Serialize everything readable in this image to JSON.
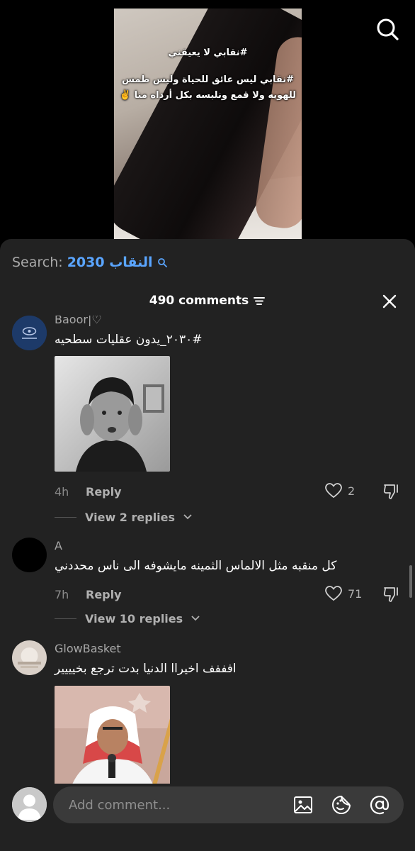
{
  "video": {
    "overlay_line1": "#نقابي لا يعيقني",
    "overlay_line2": "#نقابي ليس عائق للحياة وليس طمس",
    "overlay_line3": "للهويه ولا قمع ونلبسه بكل أرداه منا ✌️"
  },
  "search": {
    "label": "Search:",
    "term": "2030 النقاب"
  },
  "comments_header": {
    "count_label": "490 comments"
  },
  "comments": [
    {
      "username": "Baoor|♡",
      "text": "#٢٠٣٠_يدون عقليات سطحيه",
      "time": "4h",
      "reply_label": "Reply",
      "likes": "2",
      "view_replies": "View 2 replies"
    },
    {
      "username": "A",
      "text": "كل منقبه مثل الالماس الثمينه مايشوفه الى ناس محددني",
      "time": "7h",
      "reply_label": "Reply",
      "likes": "71",
      "view_replies": "View 10 replies"
    },
    {
      "username": "GlowBasket",
      "text": "افففف اخيراا الدنيا بدت ترجع بخيييير"
    }
  ],
  "composer": {
    "placeholder": "Add comment..."
  },
  "colors": {
    "sheet_bg": "#222222",
    "accent_blue": "#5aa5ff",
    "muted_text": "#a8a8a8"
  },
  "icons": [
    "search-icon",
    "filter-icon",
    "close-icon",
    "heart-icon",
    "dislike-icon",
    "chevron-down-icon",
    "image-icon",
    "emoji-icon",
    "mention-icon",
    "avatar-placeholder-icon"
  ]
}
